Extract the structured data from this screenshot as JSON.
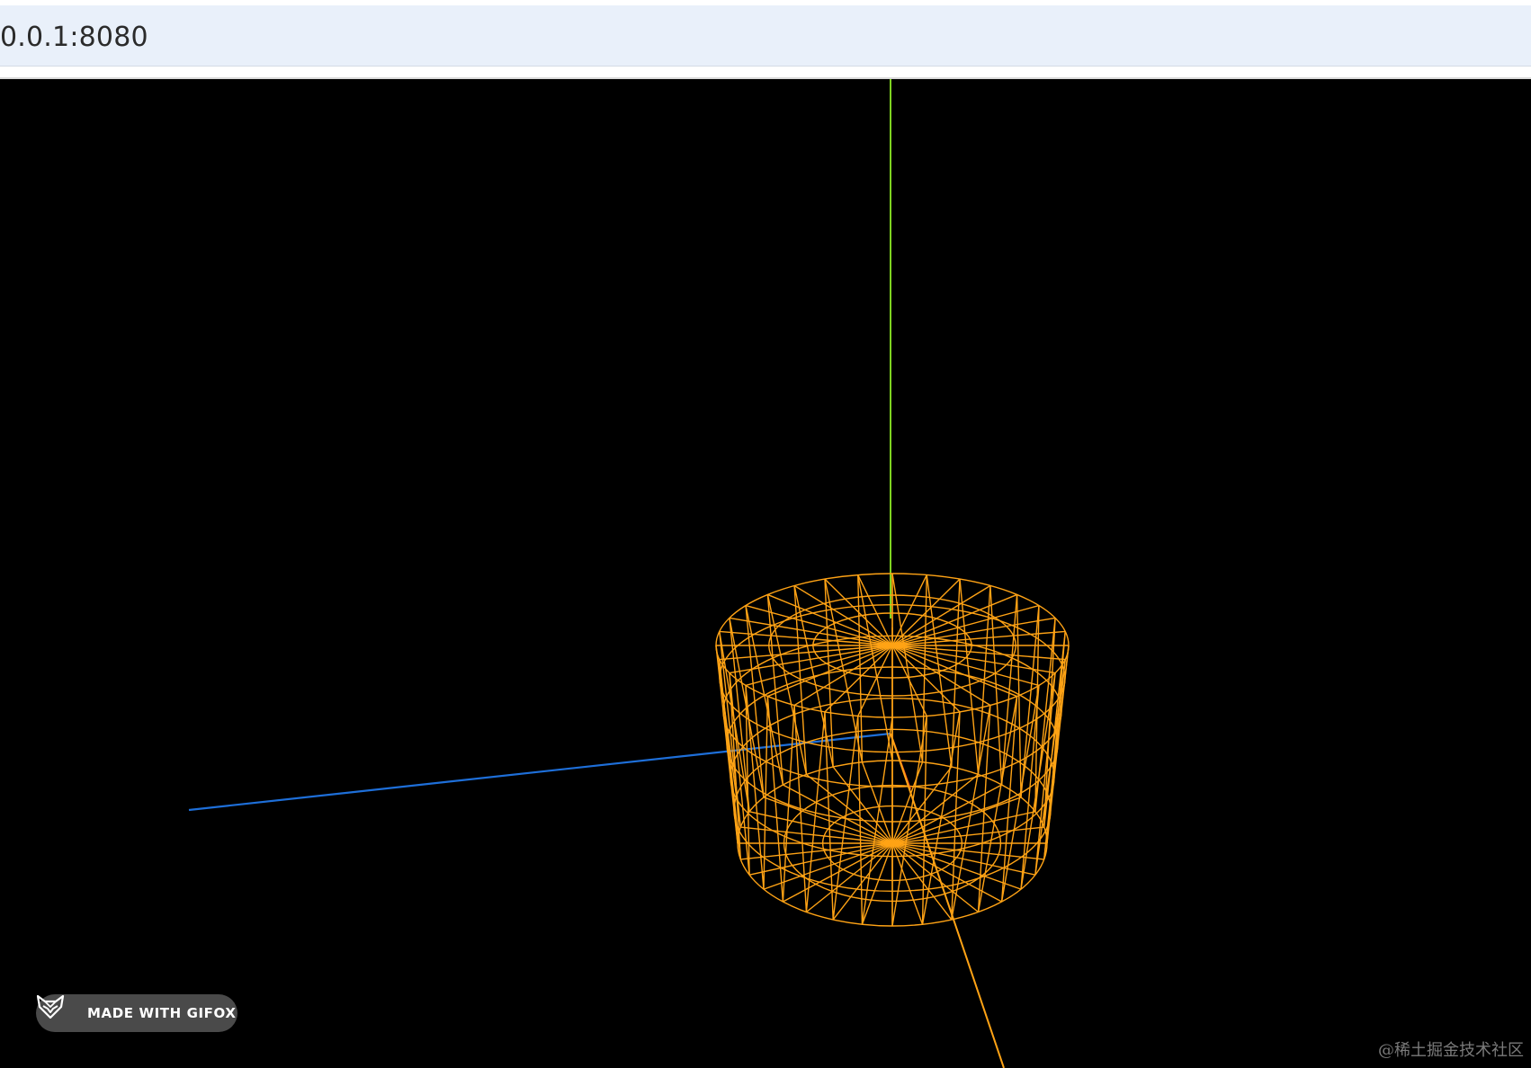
{
  "browser": {
    "address_text": "0.0.1:8080"
  },
  "scene": {
    "axis_colors": {
      "y_axis": "#7ed321",
      "z_axis": "#1e6fd9",
      "x_axis": "#ff5a1f"
    },
    "mesh_color": "#ffa315",
    "mesh_type": "cylinder-wireframe",
    "background": "#000000"
  },
  "badge": {
    "label": "MADE WITH GIFOX",
    "icon": "fox-icon"
  },
  "watermark": {
    "text": "@稀土掘金技术社区"
  }
}
